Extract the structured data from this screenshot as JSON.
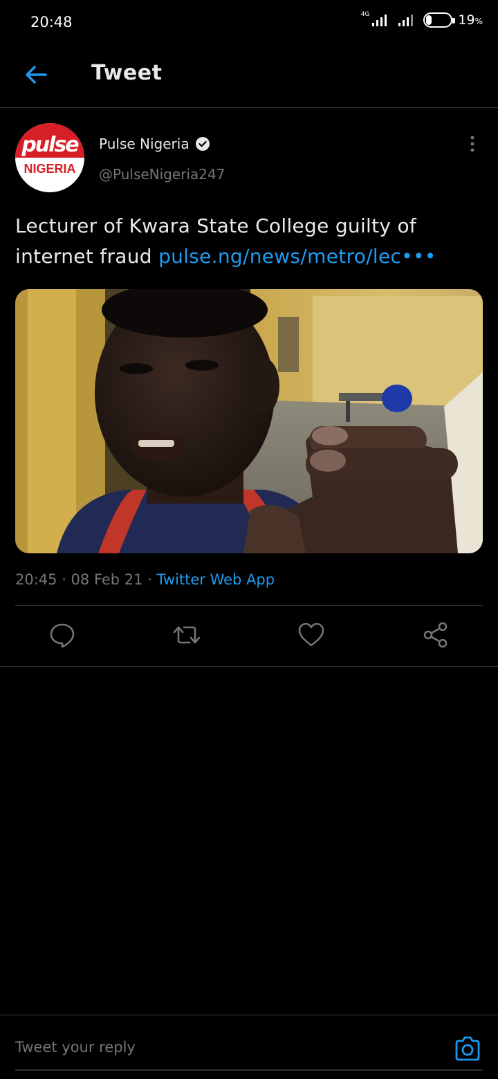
{
  "status_bar": {
    "time": "20:48",
    "network": "4G",
    "battery_percent": "19",
    "battery_unit": "%",
    "battery_level": 0.19
  },
  "header": {
    "title": "Tweet",
    "back_icon": "arrow-left-icon"
  },
  "tweet": {
    "avatar": {
      "brand_top": "pulse",
      "brand_bottom": "NIGERIA"
    },
    "author_name": "Pulse Nigeria",
    "verified_icon": "verified-badge-icon",
    "handle": "@PulseNigeria247",
    "more_icon": "more-vertical-icon",
    "text": "Lecturer of Kwara State College guilty of internet fraud ",
    "link": "pulse.ng/news/metro/lec•••",
    "timestamp": "20:45 · 08 Feb 21 · ",
    "source": "Twitter Web App"
  },
  "actions": [
    {
      "name": "reply",
      "icon": "reply-bubble-icon"
    },
    {
      "name": "retweet",
      "icon": "retweet-icon"
    },
    {
      "name": "like",
      "icon": "heart-icon"
    },
    {
      "name": "share",
      "icon": "share-icon"
    }
  ],
  "reply_bar": {
    "placeholder": "Tweet your reply",
    "camera_icon": "camera-icon"
  },
  "colors": {
    "background": "#000000",
    "accent": "#1d9bf0",
    "secondary_text": "#71767b",
    "brand_red": "#d61f26"
  }
}
